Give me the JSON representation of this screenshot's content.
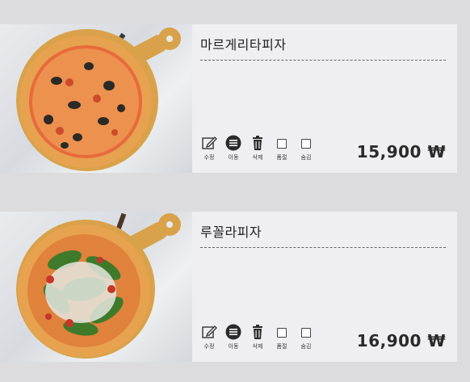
{
  "menu_items": [
    {
      "name": "마르게리타피자",
      "price": "15,900 ₩",
      "actions": {
        "edit": "수정",
        "move": "이동",
        "delete": "삭제",
        "soldout": "품절",
        "hide": "숨김"
      },
      "image_icon": "pizza-margherita-icon"
    },
    {
      "name": "루꼴라피자",
      "price": "16,900 ₩",
      "actions": {
        "edit": "수정",
        "move": "이동",
        "delete": "삭제",
        "soldout": "품절",
        "hide": "숨김"
      },
      "image_icon": "pizza-arugula-icon"
    }
  ],
  "colors": {
    "card_bg": "#efeff1",
    "page_bg": "#dcdcde",
    "board": "#d9a24a",
    "crust": "#e7a24f",
    "sauce": "#e86a3a"
  }
}
